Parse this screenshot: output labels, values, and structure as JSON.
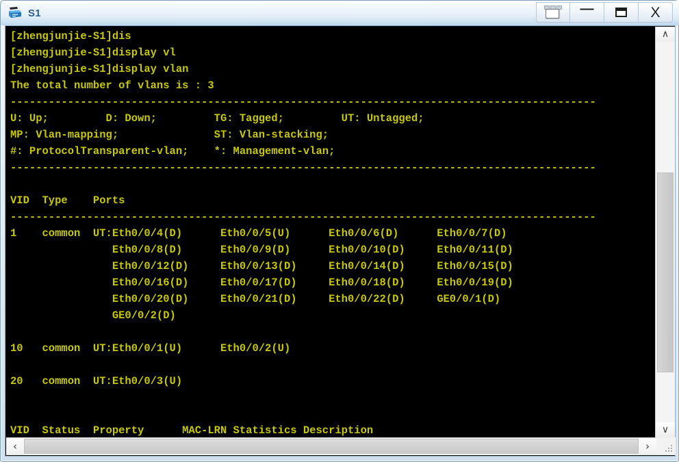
{
  "window": {
    "title": "S1",
    "app_icon": "switch-device-icon",
    "buttons": [
      {
        "name": "window-list-button",
        "label": "",
        "icon": "window-list-icon"
      },
      {
        "name": "minimize-button",
        "label": "—",
        "icon": "minimize-icon"
      },
      {
        "name": "maximize-button",
        "label": "",
        "icon": "maximize-icon"
      },
      {
        "name": "close-button",
        "label": "X",
        "icon": "close-icon"
      }
    ]
  },
  "terminal": {
    "foreground_color": "#c8c800",
    "background_color": "#000000",
    "text": "[zhengjunjie-S1]dis\n[zhengjunjie-S1]display vl\n[zhengjunjie-S1]display vlan\nThe total number of vlans is : 3\n--------------------------------------------------------------------------------------------\nU: Up;         D: Down;         TG: Tagged;         UT: Untagged;\nMP: Vlan-mapping;               ST: Vlan-stacking;\n#: ProtocolTransparent-vlan;    *: Management-vlan;\n--------------------------------------------------------------------------------------------\n\nVID  Type    Ports\n--------------------------------------------------------------------------------------------\n1    common  UT:Eth0/0/4(D)      Eth0/0/5(U)      Eth0/0/6(D)      Eth0/0/7(D)\n                Eth0/0/8(D)      Eth0/0/9(D)      Eth0/0/10(D)     Eth0/0/11(D)\n                Eth0/0/12(D)     Eth0/0/13(D)     Eth0/0/14(D)     Eth0/0/15(D)\n                Eth0/0/16(D)     Eth0/0/17(D)     Eth0/0/18(D)     Eth0/0/19(D)\n                Eth0/0/20(D)     Eth0/0/21(D)     Eth0/0/22(D)     GE0/0/1(D)\n                GE0/0/2(D)\n\n10   common  UT:Eth0/0/1(U)      Eth0/0/2(U)\n\n20   common  UT:Eth0/0/3(U)\n\n\nVID  Status  Property      MAC-LRN Statistics Description",
    "lines": {
      "prompt_1": "[zhengjunjie-S1]dis",
      "prompt_2": "[zhengjunjie-S1]display vl",
      "prompt_3": "[zhengjunjie-S1]display vlan",
      "total_vlans": "The total number of vlans is : 3",
      "legend_1": "U: Up;         D: Down;         TG: Tagged;         UT: Untagged;",
      "legend_2": "MP: Vlan-mapping;               ST: Vlan-stacking;",
      "legend_3": "#: ProtocolTransparent-vlan;    *: Management-vlan;",
      "table1_header": "VID  Type    Ports",
      "table2_header": "VID  Status  Property      MAC-LRN Statistics Description"
    },
    "vlan_table": {
      "columns": [
        "VID",
        "Type",
        "Ports"
      ],
      "rows": [
        {
          "vid": "1",
          "type": "common",
          "tag": "UT:",
          "ports": [
            "Eth0/0/4(D)",
            "Eth0/0/5(U)",
            "Eth0/0/6(D)",
            "Eth0/0/7(D)",
            "Eth0/0/8(D)",
            "Eth0/0/9(D)",
            "Eth0/0/10(D)",
            "Eth0/0/11(D)",
            "Eth0/0/12(D)",
            "Eth0/0/13(D)",
            "Eth0/0/14(D)",
            "Eth0/0/15(D)",
            "Eth0/0/16(D)",
            "Eth0/0/17(D)",
            "Eth0/0/18(D)",
            "Eth0/0/19(D)",
            "Eth0/0/20(D)",
            "Eth0/0/21(D)",
            "Eth0/0/22(D)",
            "GE0/0/1(D)",
            "GE0/0/2(D)"
          ]
        },
        {
          "vid": "10",
          "type": "common",
          "tag": "UT:",
          "ports": [
            "Eth0/0/1(U)",
            "Eth0/0/2(U)"
          ]
        },
        {
          "vid": "20",
          "type": "common",
          "tag": "UT:",
          "ports": [
            "Eth0/0/3(U)"
          ]
        }
      ]
    },
    "second_table_columns": [
      "VID",
      "Status",
      "Property",
      "MAC-LRN",
      "Statistics",
      "Description"
    ]
  },
  "scrollbars": {
    "vertical": {
      "up_arrow": "∧",
      "down_arrow": "∨"
    },
    "horizontal": {
      "left_arrow": "‹",
      "right_arrow": "›"
    }
  }
}
